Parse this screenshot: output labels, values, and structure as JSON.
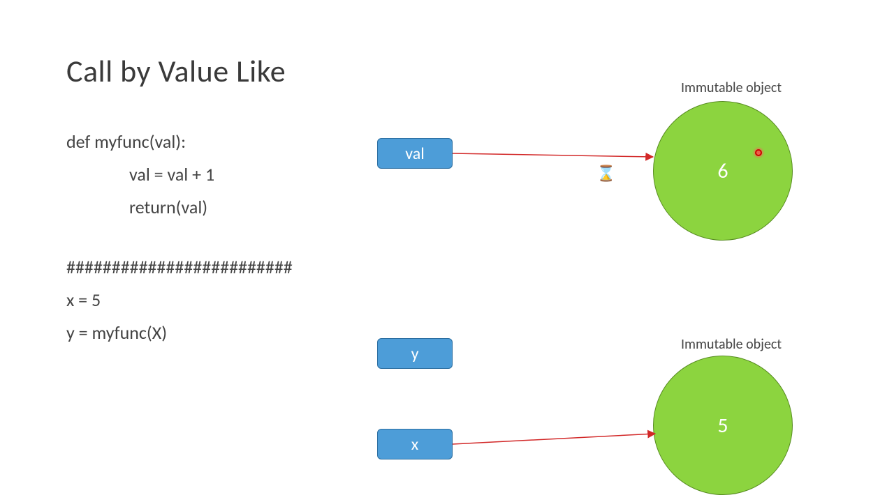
{
  "title": "Call by Value Like",
  "code": {
    "l1": "def myfunc(val):",
    "l2": "val = val + 1",
    "l3": "return(val)",
    "sep": "#########################",
    "l4": "x = 5",
    "l5": "y = myfunc(X)"
  },
  "boxes": {
    "val": "val",
    "y": "y",
    "x": "x"
  },
  "objects": {
    "top": {
      "label": "Immutable object",
      "value": "6"
    },
    "bottom": {
      "label": "Immutable object",
      "value": "5"
    }
  },
  "cursor": {
    "glyph": "⌛"
  },
  "colors": {
    "box_fill": "#4d9dd8",
    "box_stroke": "#2b6ea1",
    "circle_fill": "#8cd43f",
    "circle_stroke": "#578c21",
    "arrow": "#d22828"
  }
}
